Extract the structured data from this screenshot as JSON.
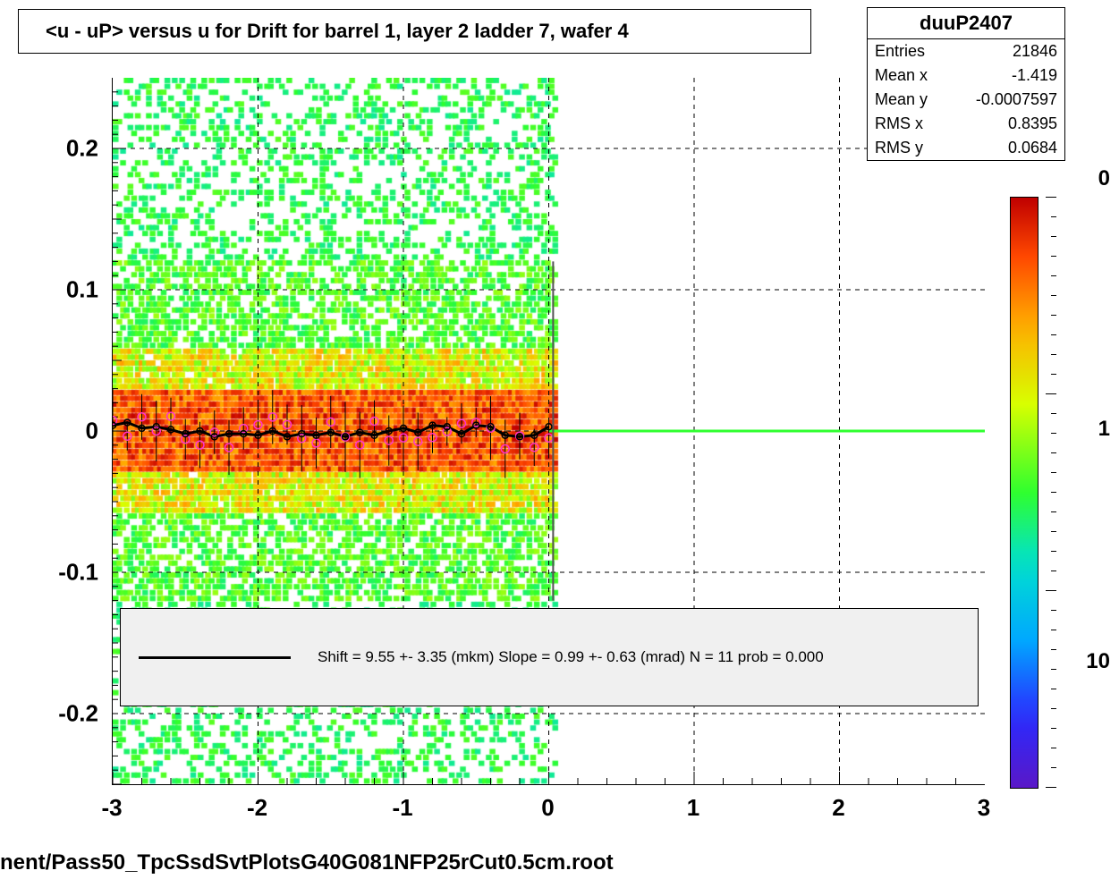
{
  "chart_data": {
    "type": "heatmap",
    "title": "<u - uP>       versus   u for Drift for barrel 1, layer 2 ladder 7, wafer 4",
    "xlabel": "",
    "ylabel": "",
    "xlim": [
      -3,
      3
    ],
    "ylim": [
      -0.25,
      0.25
    ],
    "x_ticks": [
      -3,
      -2,
      -1,
      0,
      1,
      2,
      3
    ],
    "y_ticks": [
      -0.2,
      -0.1,
      0,
      0.1,
      0.2
    ],
    "colorbar_ticks": [
      "10",
      "1"
    ],
    "heat_region_x": [
      -3,
      0.05
    ],
    "profile_points_x": [
      -3.0,
      -2.9,
      -2.8,
      -2.7,
      -2.6,
      -2.5,
      -2.4,
      -2.3,
      -2.2,
      -2.1,
      -2.0,
      -1.9,
      -1.8,
      -1.7,
      -1.6,
      -1.5,
      -1.4,
      -1.3,
      -1.2,
      -1.1,
      -1.0,
      -0.9,
      -0.8,
      -0.7,
      -0.6,
      -0.5,
      -0.4,
      -0.3,
      -0.2,
      -0.1,
      0.0
    ],
    "profile_points_y": [
      0.004,
      0.006,
      0.002,
      0.003,
      0.001,
      -0.002,
      0.0,
      -0.004,
      -0.002,
      -0.002,
      -0.003,
      0.0,
      -0.004,
      -0.002,
      -0.003,
      -0.001,
      -0.004,
      -0.001,
      -0.003,
      0.0,
      0.002,
      -0.001,
      0.004,
      0.003,
      -0.002,
      0.004,
      0.003,
      -0.003,
      -0.004,
      -0.003,
      0.003
    ],
    "fit": {
      "shift": "9.55 +- 3.35 (mkm)",
      "slope": "0.99 +- 0.63 (mrad)",
      "N": 11,
      "prob": "0.000"
    }
  },
  "stats": {
    "name": "duuP2407",
    "entries": "21846",
    "mean_x": "-1.419",
    "mean_y": "-0.0007597",
    "rms_x": "0.8395",
    "rms_y": "0.0684"
  },
  "fit_text": "Shift =      9.55 +- 3.35 (mkm) Slope =      0.99 +- 0.63 (mrad)  N = 11 prob = 0.000",
  "footer": "nent/Pass50_TpcSsdSvtPlotsG40G081NFP25rCut0.5cm.root",
  "labels": {
    "entries": "Entries",
    "meanx": "Mean x",
    "meany": "Mean y",
    "rmsx": "RMS x",
    "rmsy": "RMS y"
  },
  "cb_hidden": "0"
}
